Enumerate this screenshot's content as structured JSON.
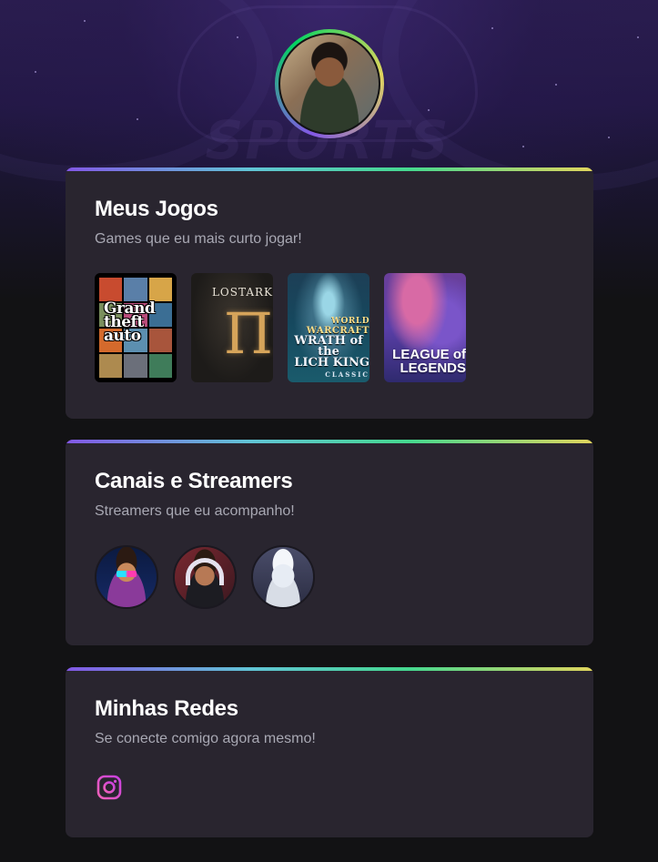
{
  "colors": {
    "background": "#121214",
    "card": "#29252f",
    "title": "#ffffff",
    "subtitle": "#a8a8b3",
    "accent_gradient": [
      "#8257e5",
      "#61c4d6",
      "#45d88f",
      "#e1d55d"
    ],
    "instagram": "#e13fc7"
  },
  "profile": {
    "avatar_icon": "user-photo-avatar"
  },
  "cards": {
    "games": {
      "title": "Meus Jogos",
      "subtitle": "Games que eu mais curto jogar!",
      "items": [
        {
          "name": "gta-v",
          "line1": "Grand",
          "line2": "theft",
          "line3": "auto"
        },
        {
          "name": "lost-ark",
          "label": "LOSTARK",
          "emblem": "Π"
        },
        {
          "name": "wow-wotlk",
          "small": "WORLD",
          "brand": "WARCRAFT",
          "line1": "WRATH of the",
          "line2": "LICH KING",
          "edition": "CLASSIC"
        },
        {
          "name": "league-of-legends",
          "line1": "LEAGUE of",
          "line2": "LEGENDS"
        }
      ]
    },
    "streamers": {
      "title": "Canais e Streamers",
      "subtitle": "Streamers que eu acompanho!"
    },
    "socials": {
      "title": "Minhas Redes",
      "subtitle": "Se conecte comigo agora mesmo!",
      "icon": "instagram-icon"
    }
  }
}
